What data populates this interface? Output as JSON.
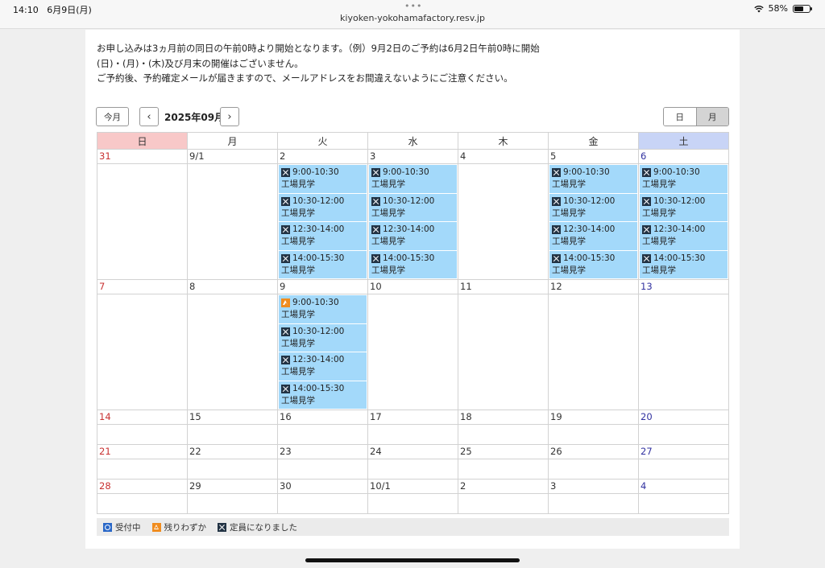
{
  "status_bar": {
    "time": "14:10",
    "date": "6月9日(月)",
    "dots": "•••",
    "url": "kiyoken-yokohamafactory.resv.jp",
    "battery": "58%"
  },
  "notice": {
    "line1": "お申し込みは3ヵ月前の同日の午前0時より開始となります。（例）9月2日のご予約は6月2日午前0時に開始",
    "line2": "(日)・(月)・(木)及び月末の開催はございません。",
    "line3": "ご予約後、予約確定メールが届きますので、メールアドレスをお間違えないようにご注意ください。"
  },
  "toolbar": {
    "today_label": "今月",
    "prev_label": "‹",
    "next_label": "›",
    "month_label": "2025年09月",
    "view_day_label": "日",
    "view_month_label": "月",
    "active_view": "month"
  },
  "calendar": {
    "weekdays": [
      "日",
      "月",
      "火",
      "水",
      "木",
      "金",
      "土"
    ],
    "weeks": [
      {
        "days": [
          {
            "label": "31",
            "slots": []
          },
          {
            "label": "9/1",
            "slots": []
          },
          {
            "label": "2",
            "slots": [
              {
                "time": "9:00-10:30",
                "title": "工場見学",
                "status": "full"
              },
              {
                "time": "10:30-12:00",
                "title": "工場見学",
                "status": "full"
              },
              {
                "time": "12:30-14:00",
                "title": "工場見学",
                "status": "full"
              },
              {
                "time": "14:00-15:30",
                "title": "工場見学",
                "status": "full"
              }
            ]
          },
          {
            "label": "3",
            "slots": [
              {
                "time": "9:00-10:30",
                "title": "工場見学",
                "status": "full"
              },
              {
                "time": "10:30-12:00",
                "title": "工場見学",
                "status": "full"
              },
              {
                "time": "12:30-14:00",
                "title": "工場見学",
                "status": "full"
              },
              {
                "time": "14:00-15:30",
                "title": "工場見学",
                "status": "full"
              }
            ]
          },
          {
            "label": "4",
            "slots": []
          },
          {
            "label": "5",
            "slots": [
              {
                "time": "9:00-10:30",
                "title": "工場見学",
                "status": "full"
              },
              {
                "time": "10:30-12:00",
                "title": "工場見学",
                "status": "full"
              },
              {
                "time": "12:30-14:00",
                "title": "工場見学",
                "status": "full"
              },
              {
                "time": "14:00-15:30",
                "title": "工場見学",
                "status": "full"
              }
            ]
          },
          {
            "label": "6",
            "slots": [
              {
                "time": "9:00-10:30",
                "title": "工場見学",
                "status": "full"
              },
              {
                "time": "10:30-12:00",
                "title": "工場見学",
                "status": "full"
              },
              {
                "time": "12:30-14:00",
                "title": "工場見学",
                "status": "full"
              },
              {
                "time": "14:00-15:30",
                "title": "工場見学",
                "status": "full"
              }
            ]
          }
        ]
      },
      {
        "days": [
          {
            "label": "7",
            "slots": []
          },
          {
            "label": "8",
            "slots": []
          },
          {
            "label": "9",
            "slots": [
              {
                "time": "9:00-10:30",
                "title": "工場見学",
                "status": "few"
              },
              {
                "time": "10:30-12:00",
                "title": "工場見学",
                "status": "full"
              },
              {
                "time": "12:30-14:00",
                "title": "工場見学",
                "status": "full"
              },
              {
                "time": "14:00-15:30",
                "title": "工場見学",
                "status": "full"
              }
            ]
          },
          {
            "label": "10",
            "slots": []
          },
          {
            "label": "11",
            "slots": []
          },
          {
            "label": "12",
            "slots": []
          },
          {
            "label": "13",
            "slots": []
          }
        ]
      },
      {
        "days": [
          {
            "label": "14",
            "slots": []
          },
          {
            "label": "15",
            "slots": []
          },
          {
            "label": "16",
            "slots": []
          },
          {
            "label": "17",
            "slots": []
          },
          {
            "label": "18",
            "slots": []
          },
          {
            "label": "19",
            "slots": []
          },
          {
            "label": "20",
            "slots": []
          }
        ]
      },
      {
        "days": [
          {
            "label": "21",
            "slots": []
          },
          {
            "label": "22",
            "slots": []
          },
          {
            "label": "23",
            "slots": []
          },
          {
            "label": "24",
            "slots": []
          },
          {
            "label": "25",
            "slots": []
          },
          {
            "label": "26",
            "slots": []
          },
          {
            "label": "27",
            "slots": []
          }
        ]
      },
      {
        "days": [
          {
            "label": "28",
            "slots": []
          },
          {
            "label": "29",
            "slots": []
          },
          {
            "label": "30",
            "slots": []
          },
          {
            "label": "10/1",
            "slots": []
          },
          {
            "label": "2",
            "slots": []
          },
          {
            "label": "3",
            "slots": []
          },
          {
            "label": "4",
            "slots": []
          }
        ]
      }
    ]
  },
  "legend": {
    "open": "受付中",
    "few": "残りわずか",
    "full": "定員になりました"
  },
  "icons": {
    "open": "circle-icon",
    "few": "triangle-icon",
    "full": "cross-icon"
  },
  "colors": {
    "slot_bg": "#a3d9fa",
    "sunday_header": "#f8c8c8",
    "saturday_header": "#c8d4f6",
    "sunday_text": "#c83232",
    "saturday_text": "#3232a0"
  }
}
